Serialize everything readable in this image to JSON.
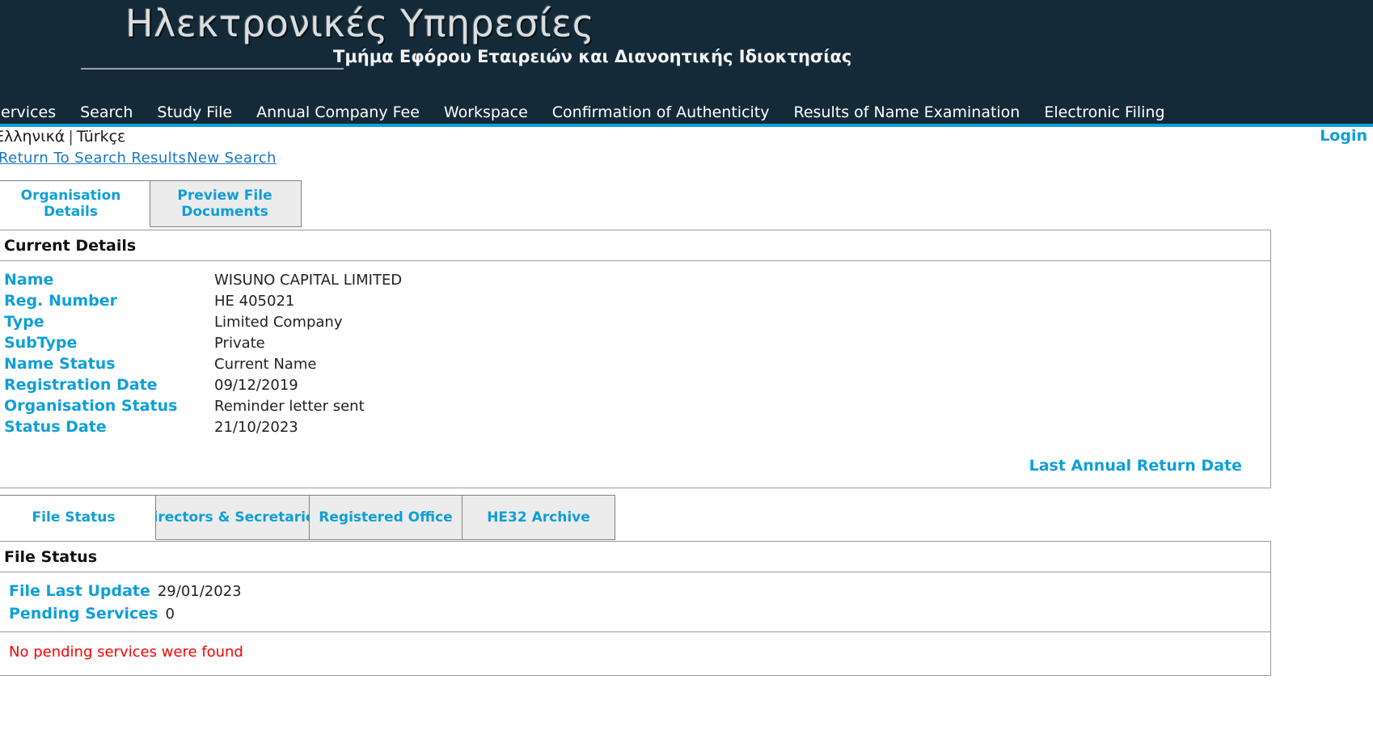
{
  "header": {
    "title": "Ηλεκτρονικές Υπηρεσίες",
    "subtitle": "Τμήμα Εφόρου Εταιρειών και Διανοητικής Ιδιοκτησίας"
  },
  "nav": {
    "items": [
      {
        "label": "Services"
      },
      {
        "label": "Search"
      },
      {
        "label": "Study File"
      },
      {
        "label": "Annual Company Fee"
      },
      {
        "label": "Workspace"
      },
      {
        "label": "Confirmation of Authenticity"
      },
      {
        "label": "Results of Name Examination"
      },
      {
        "label": "Electronic Filing"
      }
    ]
  },
  "utility": {
    "lang_greek": "Ελληνικά",
    "lang_separator": "|",
    "lang_turkish": "Türkçε",
    "login": "Login"
  },
  "actions": {
    "return_to_search": "Return To Search Results",
    "new_search": "New Search"
  },
  "outer_tabs": [
    {
      "label": "Organisation Details",
      "active": true
    },
    {
      "label": "Preview File Documents",
      "active": false
    }
  ],
  "current_details": {
    "heading": "Current Details",
    "rows": [
      {
        "label": "Name",
        "value": "WISUNO CAPITAL LIMITED"
      },
      {
        "label": "Reg. Number",
        "value": "HE 405021"
      },
      {
        "label": "Type",
        "value": "Limited Company"
      },
      {
        "label": "SubType",
        "value": "Private"
      },
      {
        "label": "Name Status",
        "value": "Current Name"
      },
      {
        "label": "Registration Date",
        "value": "09/12/2019"
      },
      {
        "label": "Organisation Status",
        "value": "Reminder letter sent"
      },
      {
        "label": "Status Date",
        "value": "21/10/2023"
      }
    ],
    "last_annual_return_date": "Last Annual Return Date"
  },
  "inner_tabs": [
    {
      "label": "File Status",
      "active": true
    },
    {
      "label": "Directors & Secretaries",
      "active": false
    },
    {
      "label": "Registered Office",
      "active": false
    },
    {
      "label": "HE32 Archive",
      "active": false
    }
  ],
  "file_status": {
    "heading": "File Status",
    "rows": [
      {
        "label": "File Last Update",
        "value": "29/01/2023"
      },
      {
        "label": "Pending Services",
        "value": "0"
      }
    ],
    "message": "No pending services were found"
  },
  "colors": {
    "header_bg": "#152a38",
    "accent": "#0f9fd8",
    "link": "#1878c0",
    "error": "#ff0000",
    "tab_inactive_bg": "#ececec"
  }
}
